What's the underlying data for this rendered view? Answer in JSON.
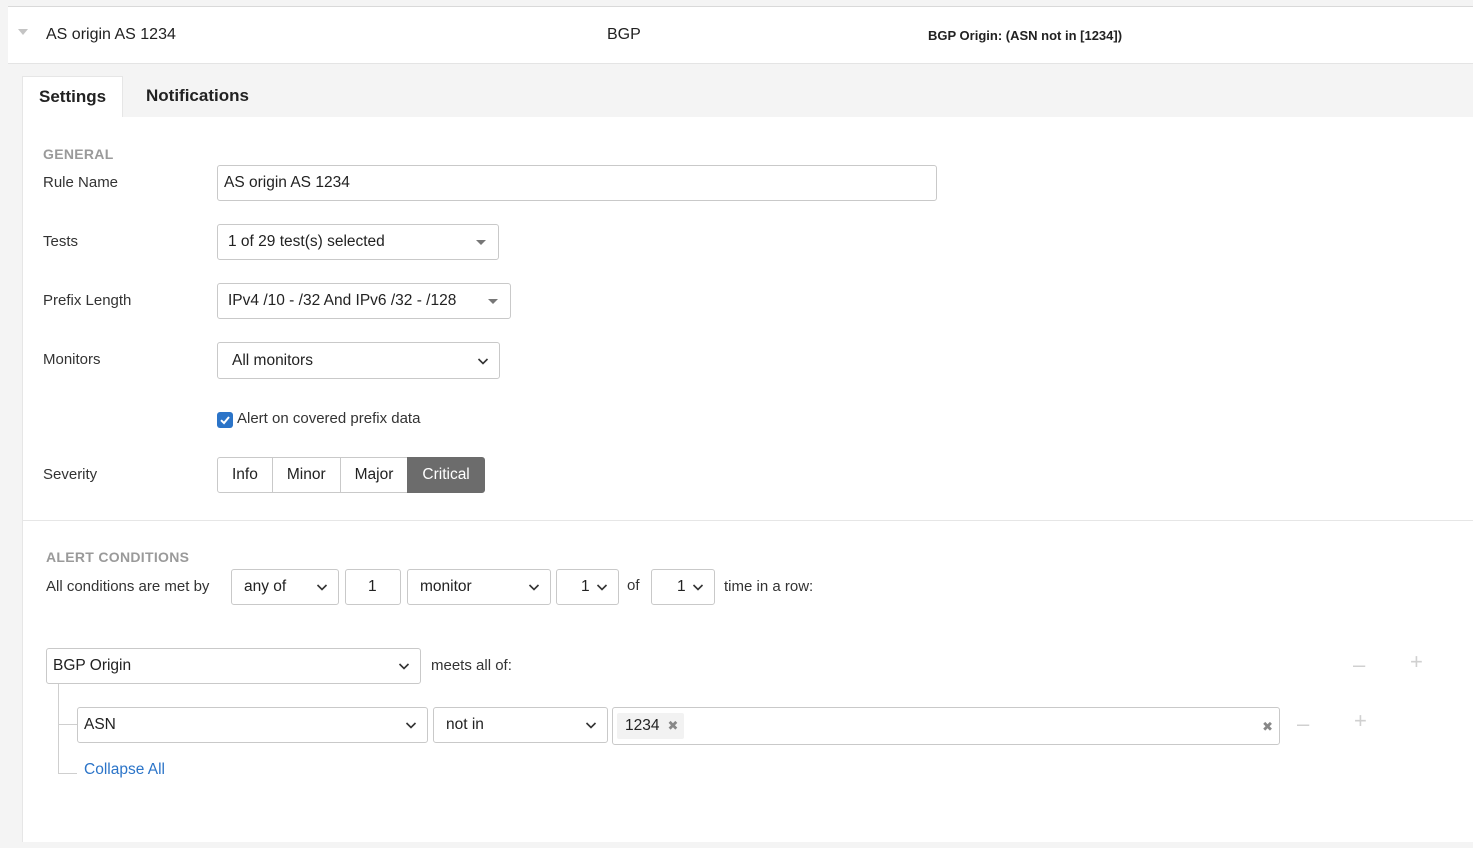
{
  "header": {
    "rule_name": "AS origin AS 1234",
    "alert_type": "BGP",
    "summary": "BGP Origin: (ASN not in [1234])"
  },
  "tabs": [
    {
      "label": "Settings",
      "active": true
    },
    {
      "label": "Notifications",
      "active": false
    }
  ],
  "general": {
    "section_title": "GENERAL",
    "rule_name_label": "Rule Name",
    "rule_name_value": "AS origin AS 1234",
    "tests_label": "Tests",
    "tests_value": "1 of 29 test(s) selected",
    "prefix_length_label": "Prefix Length",
    "prefix_length_value": "IPv4 /10 - /32 And IPv6 /32 - /128",
    "monitors_label": "Monitors",
    "monitors_value": "All monitors",
    "covered_prefix_label": "Alert on covered prefix data",
    "covered_prefix_checked": true,
    "severity_label": "Severity",
    "severity_options": [
      "Info",
      "Minor",
      "Major",
      "Critical"
    ],
    "severity_selected": "Critical"
  },
  "alert_conditions": {
    "section_title": "ALERT CONDITIONS",
    "prefix_text": "All conditions are met by",
    "match_mode": "any of",
    "count": "1",
    "unit": "monitor",
    "rounds_value": "1",
    "of_text": "of",
    "rounds_total": "1",
    "suffix_text": "time in a row:",
    "condition_metric": "BGP Origin",
    "meets_text": "meets all of:",
    "sub_field": "ASN",
    "sub_operator": "not in",
    "sub_values": [
      "1234"
    ],
    "collapse_label": "Collapse All"
  },
  "icons": {
    "expand": "chevron-down-icon",
    "checkbox": "check-icon",
    "remove": "minus-icon",
    "add": "plus-icon",
    "clear": "close-icon"
  },
  "colors": {
    "accent": "#2b74c8",
    "selected_segment": "#6c6c6c",
    "section_title": "#9a9a9a"
  }
}
